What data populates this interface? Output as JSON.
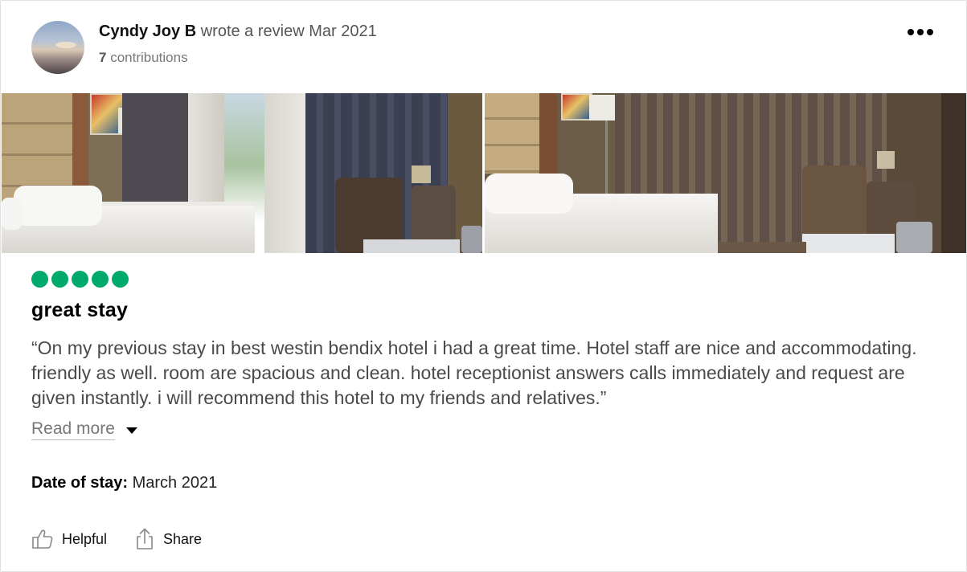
{
  "reviewer": {
    "name": "Cyndy Joy B",
    "action": "wrote a review Mar 2021",
    "contributions_count": "7",
    "contributions_label": "contributions"
  },
  "review": {
    "rating": 5,
    "rating_max": 5,
    "rating_color": "#00aa6c",
    "title": "great stay",
    "text": "“On my previous stay in best westin bendix hotel i had a great time. Hotel staff are nice and accommodating. friendly as well. room are spacious and clean. hotel receptionist answers calls immediately and request are given instantly. i will recommend this hotel to my friends and relatives.”",
    "read_more": "Read more",
    "date_of_stay_label": "Date of stay:",
    "date_of_stay_value": "March 2021"
  },
  "actions": {
    "helpful": "Helpful",
    "share": "Share"
  },
  "icons": {
    "more": "more-options-icon",
    "helpful": "thumbs-up-icon",
    "share": "share-icon",
    "read_more": "caret-down-icon"
  }
}
